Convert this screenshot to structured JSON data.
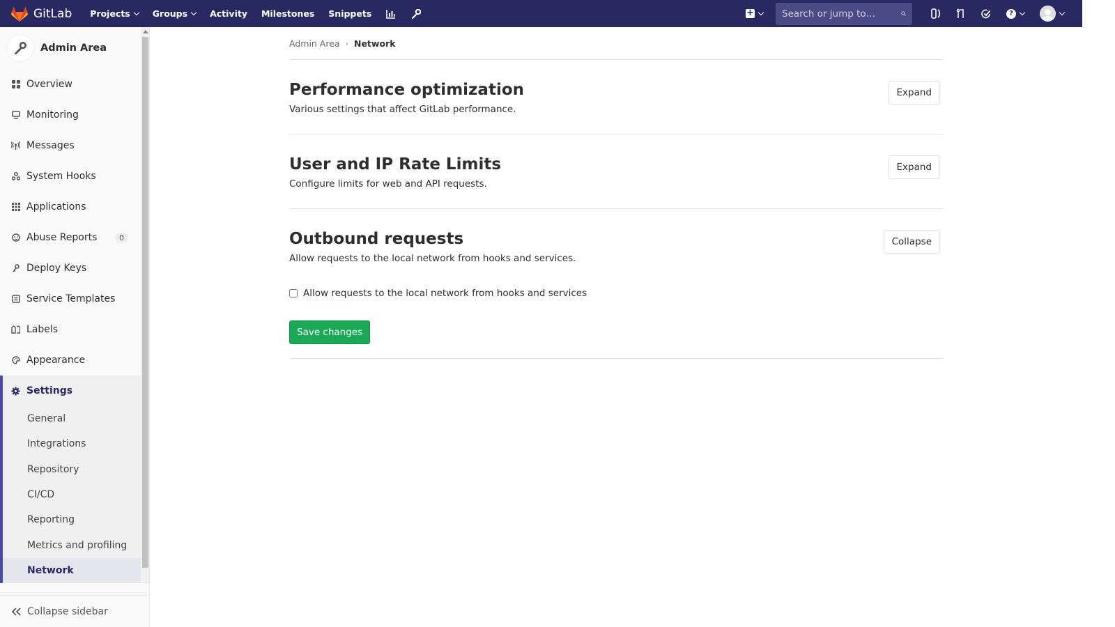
{
  "navbar": {
    "brand": "GitLab",
    "links": [
      {
        "label": "Projects",
        "dropdown": true
      },
      {
        "label": "Groups",
        "dropdown": true
      },
      {
        "label": "Activity",
        "dropdown": false
      },
      {
        "label": "Milestones",
        "dropdown": false
      },
      {
        "label": "Snippets",
        "dropdown": false
      }
    ],
    "search_placeholder": "Search or jump to…",
    "colors": {
      "background": "#292961",
      "search_bg": "#4a4a85"
    }
  },
  "sidebar": {
    "title": "Admin Area",
    "items": [
      {
        "label": "Overview",
        "icon": "overview-icon"
      },
      {
        "label": "Monitoring",
        "icon": "monitor-icon"
      },
      {
        "label": "Messages",
        "icon": "broadcast-icon"
      },
      {
        "label": "System Hooks",
        "icon": "hook-icon"
      },
      {
        "label": "Applications",
        "icon": "grid-icon"
      },
      {
        "label": "Abuse Reports",
        "icon": "face-icon",
        "badge": "0"
      },
      {
        "label": "Deploy Keys",
        "icon": "key-icon"
      },
      {
        "label": "Service Templates",
        "icon": "template-icon"
      },
      {
        "label": "Labels",
        "icon": "label-icon"
      },
      {
        "label": "Appearance",
        "icon": "palette-icon"
      }
    ],
    "settings": {
      "label": "Settings",
      "sub_items": [
        {
          "label": "General"
        },
        {
          "label": "Integrations"
        },
        {
          "label": "Repository"
        },
        {
          "label": "CI/CD"
        },
        {
          "label": "Reporting"
        },
        {
          "label": "Metrics and profiling"
        },
        {
          "label": "Network",
          "active": true
        }
      ]
    },
    "collapse_label": "Collapse sidebar"
  },
  "breadcrumb": {
    "parent": "Admin Area",
    "current": "Network"
  },
  "sections": [
    {
      "title": "Performance optimization",
      "description": "Various settings that affect GitLab performance.",
      "button": "Expand"
    },
    {
      "title": "User and IP Rate Limits",
      "description": "Configure limits for web and API requests.",
      "button": "Expand"
    },
    {
      "title": "Outbound requests",
      "description": "Allow requests to the local network from hooks and services.",
      "button": "Collapse",
      "checkbox_label": "Allow requests to the local network from hooks and services",
      "checkbox_checked": false,
      "save_label": "Save changes"
    }
  ]
}
